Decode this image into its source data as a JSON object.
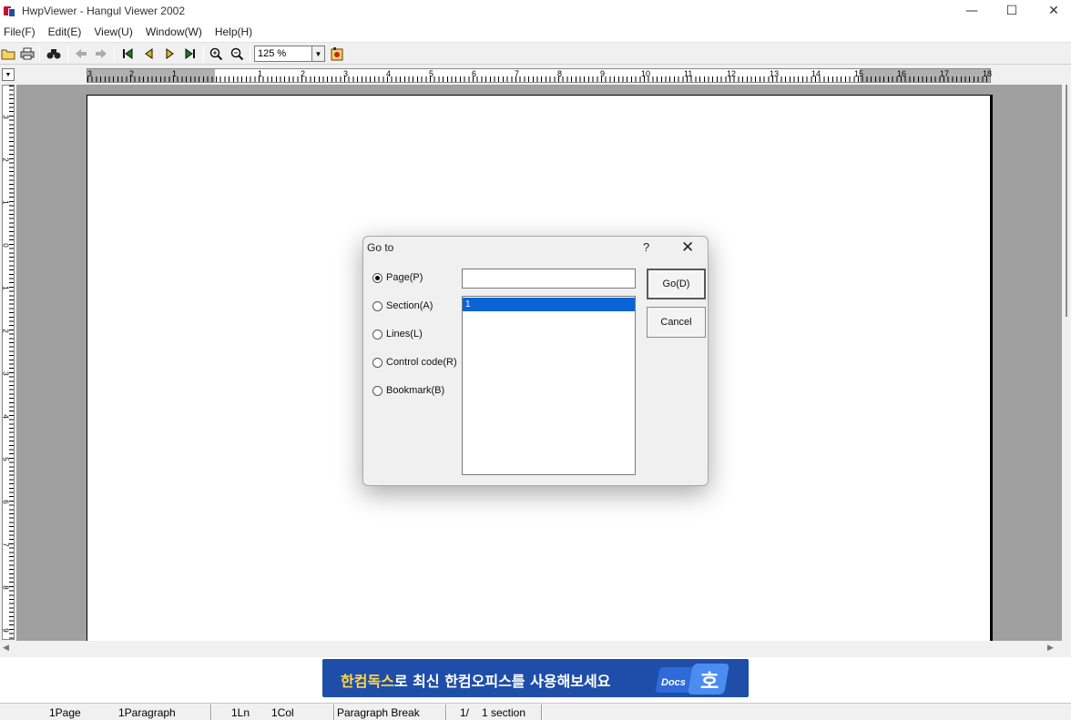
{
  "window": {
    "title": "HwpViewer - Hangul Viewer 2002"
  },
  "menu": {
    "items": [
      "File(F)",
      "Edit(E)",
      "View(U)",
      "Window(W)",
      "Help(H)"
    ]
  },
  "toolbar": {
    "zoom": "125 %"
  },
  "ruler": {
    "h_labels": [
      "3",
      "2",
      "1",
      "1",
      "2",
      "3",
      "4",
      "5",
      "6",
      "7",
      "8",
      "9",
      "10",
      "11",
      "12",
      "13",
      "14",
      "15",
      "16",
      "17",
      "18"
    ],
    "v_labels": [
      "3",
      "2",
      "1",
      "0",
      "1",
      "2",
      "3",
      "4",
      "5",
      "6",
      "7",
      "8",
      "9"
    ]
  },
  "dialog": {
    "title": "Go to",
    "help": "?",
    "options": [
      "Page(P)",
      "Section(A)",
      "Lines(L)",
      "Control code(R)",
      "Bookmark(B)"
    ],
    "selected_option": "Page(P)",
    "page_input_value": "",
    "list_items": [
      "1"
    ],
    "go_label": "Go(D)",
    "cancel_label": "Cancel"
  },
  "banner": {
    "highlight": "한컴독스",
    "text": "로 최신 한컴오피스를 사용해보세요",
    "logo_docs": "Docs",
    "logo_char": "호"
  },
  "status": {
    "page": "1Page",
    "paragraph": "1Paragraph",
    "line": "1Ln",
    "col": "1Col",
    "break": "Paragraph Break",
    "section_pos": "1/",
    "section_count": "1 section"
  }
}
